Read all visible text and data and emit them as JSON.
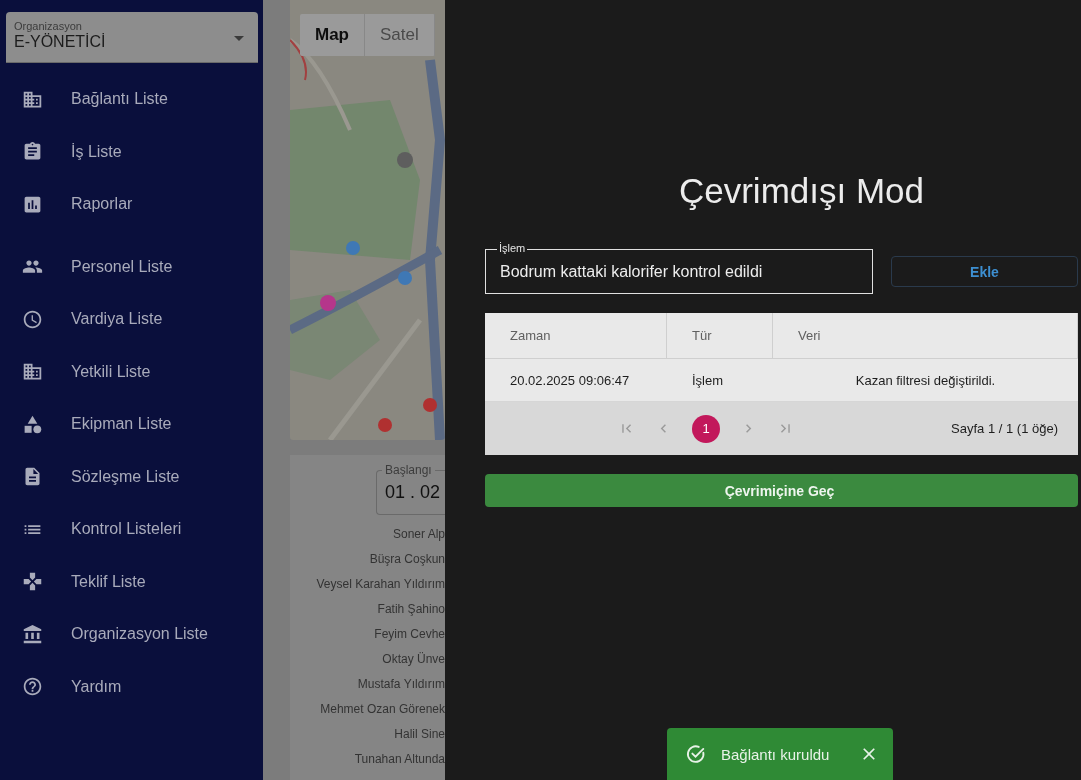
{
  "sidebar": {
    "organization": {
      "label": "Organizasyon",
      "value": "E-YÖNETİCİ"
    },
    "sections": [
      {
        "items": [
          {
            "label": "Bağlantı Liste"
          },
          {
            "label": "İş Liste"
          },
          {
            "label": "Raporlar"
          }
        ]
      },
      {
        "items": [
          {
            "label": "Personel Liste"
          },
          {
            "label": "Vardiya Liste"
          },
          {
            "label": "Yetkili Liste"
          },
          {
            "label": "Ekipman Liste"
          },
          {
            "label": "Sözleşme Liste"
          },
          {
            "label": "Kontrol Listeleri"
          },
          {
            "label": "Teklif Liste"
          },
          {
            "label": "Organizasyon Liste"
          },
          {
            "label": "Yardım"
          }
        ]
      }
    ]
  },
  "main": {
    "map": {
      "tabs": [
        {
          "label": "Map",
          "selected": true
        },
        {
          "label": "Satel",
          "selected": false
        }
      ]
    },
    "date_field": {
      "label": "Başlangı",
      "value": "01 . 02"
    },
    "names": [
      "Soner Alp",
      "Büşra Coşkun",
      "Veysel Karahan Yıldırım",
      "Fatih Şahino",
      "Feyim Cevhe",
      "Oktay Ünve",
      "Mustafa Yıldırım",
      "Mehmet Ozan Görenek",
      "Halil Sine",
      "Tunahan Altunda"
    ]
  },
  "dialog": {
    "title": "Çevrimdışı Mod",
    "field": {
      "label": "İşlem",
      "value": "Bodrum kattaki kalorifer kontrol edildi"
    },
    "add_button": "Ekle",
    "table": {
      "columns": [
        "Zaman",
        "Tür",
        "Veri"
      ],
      "rows": [
        [
          "20.02.2025 09:06:47",
          "İşlem",
          "Kazan filtresi değiştirildi."
        ]
      ]
    },
    "pager": {
      "nav_disabled": true,
      "pages": [
        {
          "label": "1",
          "selected": true
        }
      ],
      "summary": "Sayfa 1 / 1 (1 öğe)"
    },
    "online_button": "Çevrimiçine Geç"
  },
  "toast": {
    "message": "Bağlantı kuruldu"
  }
}
